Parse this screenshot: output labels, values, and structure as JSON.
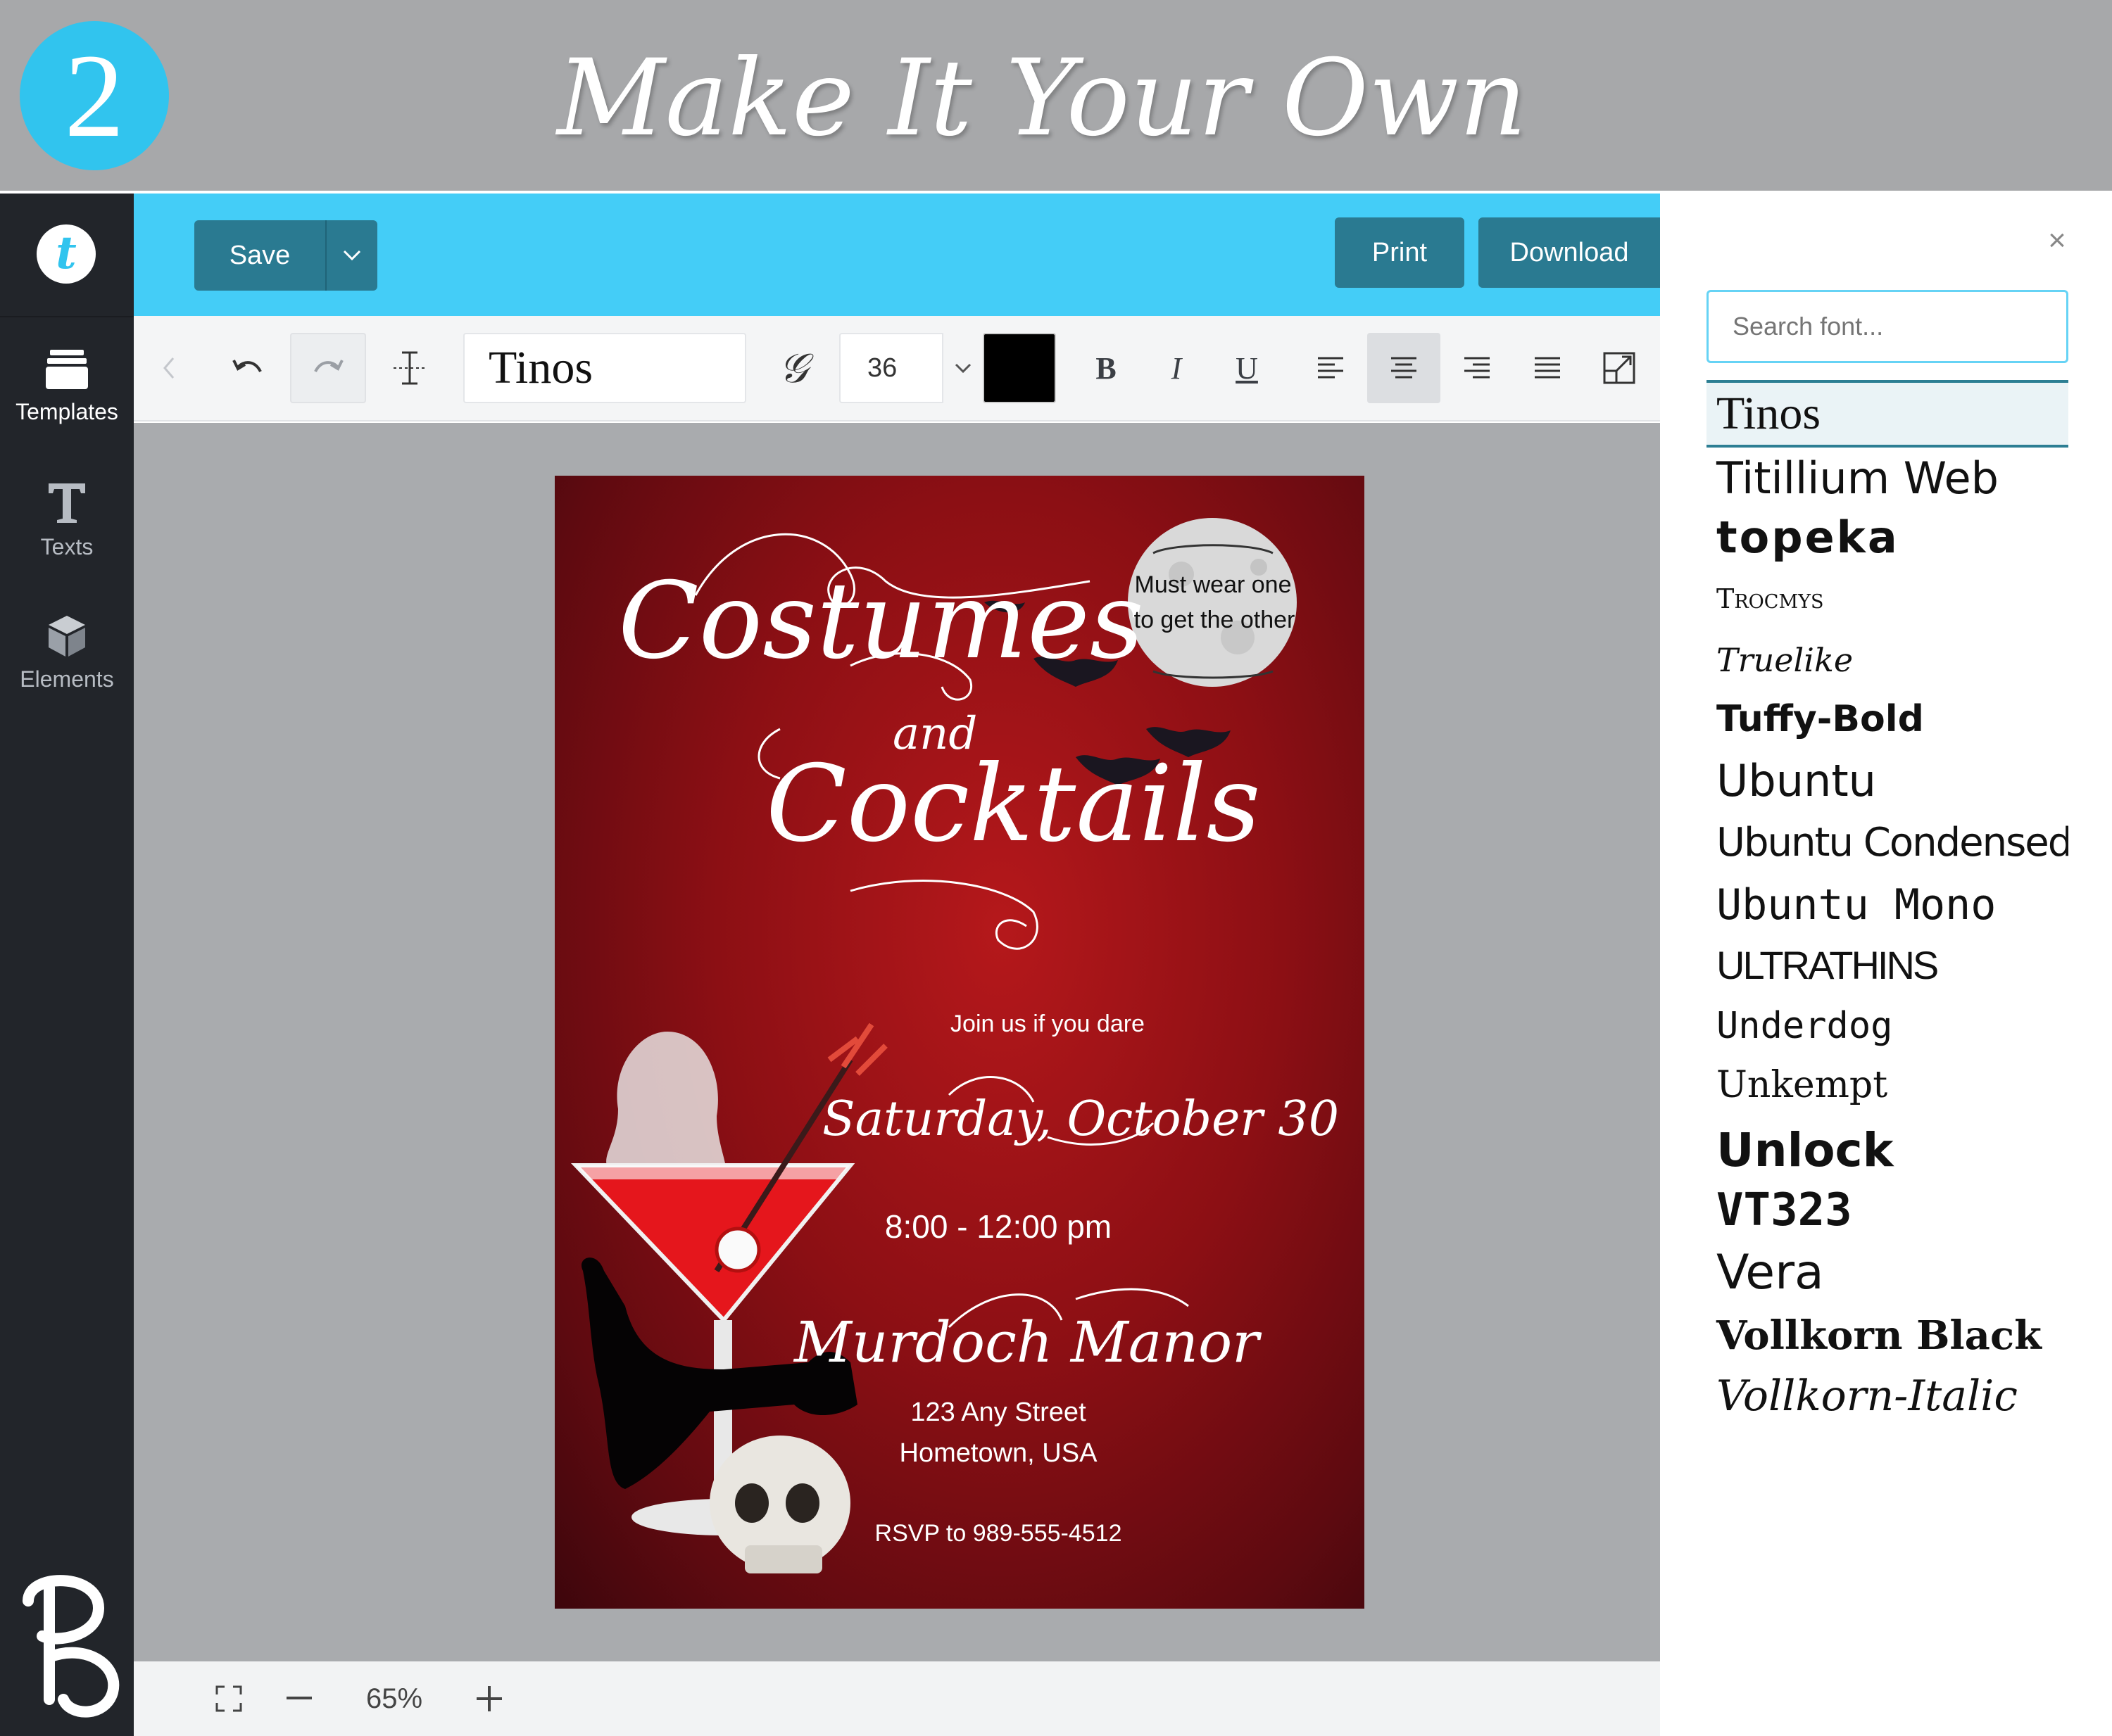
{
  "banner": {
    "step": "2",
    "title": "Make It Your Own"
  },
  "sidebar": {
    "logo_letter": "t",
    "items": [
      {
        "label": "Templates",
        "icon": "layers-icon"
      },
      {
        "label": "Texts",
        "icon": "text-icon"
      },
      {
        "label": "Elements",
        "icon": "cube-icon"
      }
    ]
  },
  "header": {
    "save_label": "Save",
    "print_label": "Print",
    "download_label": "Download"
  },
  "toolbar": {
    "font_name": "Tinos",
    "font_size": "36",
    "text_color": "#000000",
    "align": "center"
  },
  "zoom": {
    "level": "65%"
  },
  "colors": {
    "accent": "#44cdf7",
    "button": "#2a7a91",
    "banner": "#a7a8aa",
    "sidebar": "#22252a"
  },
  "card": {
    "title_1": "Costumes",
    "title_and": "and",
    "title_2": "Cocktails",
    "moon_line_1": "Must wear one",
    "moon_line_2": "to get the other",
    "tagline": "Join us if you dare",
    "date": "Saturday, October 30",
    "time": "8:00 - 12:00 pm",
    "venue": "Murdoch Manor",
    "address_1": "123 Any Street",
    "address_2": "Hometown, USA",
    "rsvp": "RSVP to 989-555-4512"
  },
  "font_panel": {
    "search_placeholder": "Search font...",
    "fonts": [
      "Tinos",
      "Titillium Web",
      "topeka",
      "Trocmys",
      "Truelike",
      "Tuffy-Bold",
      "Ubuntu",
      "Ubuntu Condensed",
      "Ubuntu Mono",
      "ULTRATHINS",
      "Underdog",
      "Unkempt",
      "Unlock",
      "VT323",
      "Vera",
      "Vollkorn Black",
      "Vollkorn-Italic"
    ],
    "selected": "Tinos"
  }
}
